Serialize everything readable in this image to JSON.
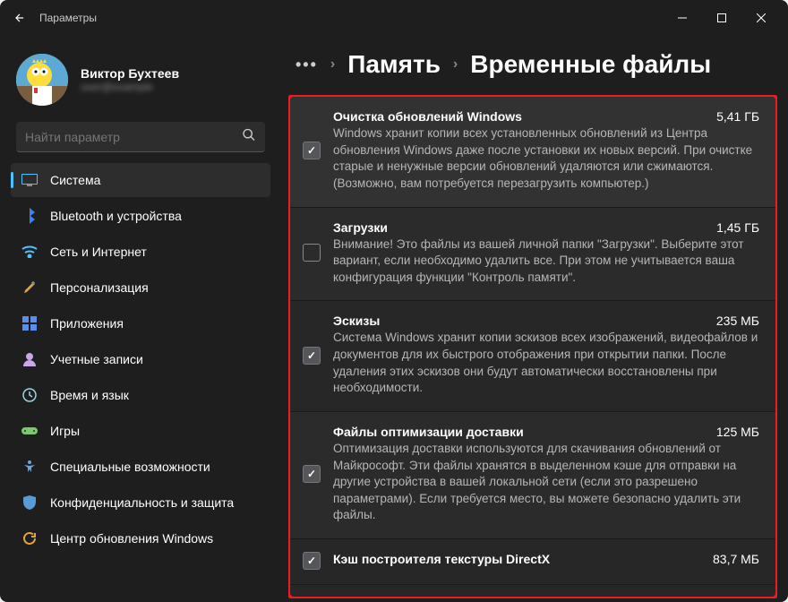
{
  "window": {
    "title": "Параметры"
  },
  "profile": {
    "name": "Виктор Бухтеев",
    "sub": "user@example"
  },
  "search": {
    "placeholder": "Найти параметр"
  },
  "sidebar": {
    "items": [
      {
        "label": "Система",
        "icon": "system",
        "active": true
      },
      {
        "label": "Bluetooth и устройства",
        "icon": "bluetooth"
      },
      {
        "label": "Сеть и Интернет",
        "icon": "wifi"
      },
      {
        "label": "Персонализация",
        "icon": "brush"
      },
      {
        "label": "Приложения",
        "icon": "apps"
      },
      {
        "label": "Учетные записи",
        "icon": "person"
      },
      {
        "label": "Время и язык",
        "icon": "clock"
      },
      {
        "label": "Игры",
        "icon": "game"
      },
      {
        "label": "Специальные возможности",
        "icon": "accessibility"
      },
      {
        "label": "Конфиденциальность и защита",
        "icon": "shield"
      },
      {
        "label": "Центр обновления Windows",
        "icon": "update"
      }
    ]
  },
  "breadcrumb": {
    "parent": "Память",
    "current": "Временные файлы"
  },
  "items": [
    {
      "title": "Очистка обновлений Windows",
      "size": "5,41 ГБ",
      "desc": "Windows хранит копии всех установленных обновлений из Центра обновления Windows даже после установки их новых версий. При очистке старые и ненужные версии обновлений удаляются или сжимаются. (Возможно, вам потребуется перезагрузить компьютер.)",
      "checked": true
    },
    {
      "title": "Загрузки",
      "size": "1,45 ГБ",
      "desc": "Внимание! Это файлы из вашей личной папки \"Загрузки\". Выберите этот вариант, если необходимо удалить все. При этом не учитывается ваша конфигурация функции \"Контроль памяти\".",
      "checked": false
    },
    {
      "title": "Эскизы",
      "size": "235 МБ",
      "desc": "Система Windows хранит копии эскизов всех изображений, видеофайлов и документов для их быстрого отображения при открытии папки. После удаления этих эскизов они будут автоматически восстановлены при необходимости.",
      "checked": true
    },
    {
      "title": "Файлы оптимизации доставки",
      "size": "125 МБ",
      "desc": "Оптимизация доставки используются для скачивания обновлений от Майкрософт. Эти файлы хранятся в выделенном кэше для отправки на другие устройства в вашей локальной сети (если это разрешено параметрами). Если требуется место, вы можете безопасно удалить эти файлы.",
      "checked": true
    },
    {
      "title": "Кэш построителя текстуры DirectX",
      "size": "83,7 МБ",
      "desc": "",
      "checked": true
    }
  ]
}
